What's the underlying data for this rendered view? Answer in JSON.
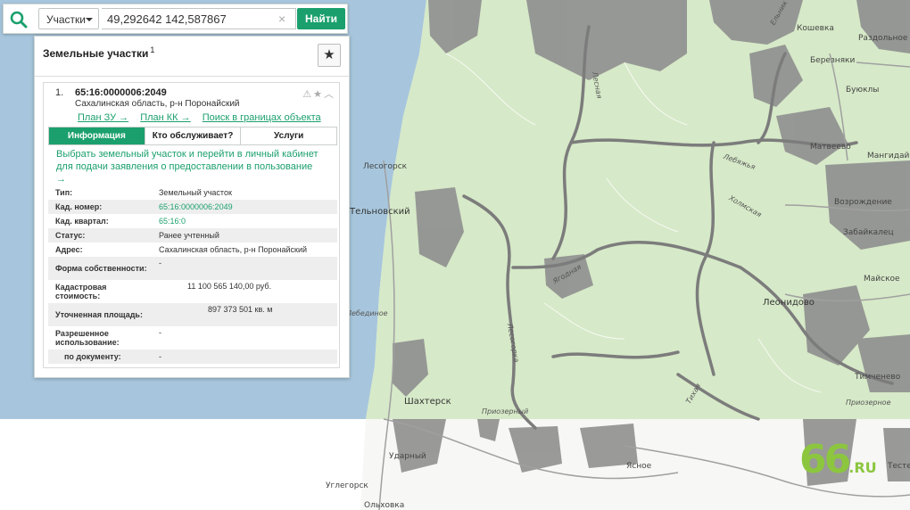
{
  "search": {
    "type_label": "Участки",
    "query_value": "49,292642 142,587867",
    "clear_symbol": "×",
    "submit_label": "Найти"
  },
  "panel": {
    "title": "Земельные участки",
    "title_count": "1",
    "favorite_symbol": "★",
    "result": {
      "index": "1.",
      "cadastral_number": "65:16:0000006:2049",
      "region": "Сахалинская область, р-н Поронайский",
      "tool_symbols": "⚠★︿",
      "links": [
        "План ЗУ →",
        "План КК →",
        "Поиск в границах объекта →"
      ],
      "tabs": [
        "Информация",
        "Кто обслуживает?",
        "Услуги"
      ],
      "cta": "Выбрать земельный участок и перейти в личный кабинет для подачи заявления о предоставлении в пользование →",
      "rows": [
        {
          "k": "Тип:",
          "v": "Земельный участок"
        },
        {
          "k": "Кад. номер:",
          "v": "65:16:0000006:2049"
        },
        {
          "k": "Кад. квартал:",
          "v": "65:16:0"
        },
        {
          "k": "Статус:",
          "v": "Ранее учтенный"
        },
        {
          "k": "Адрес:",
          "v": "Сахалинская область, р-н Поронайский"
        },
        {
          "k": "Форма собственности:",
          "v": "-"
        },
        {
          "k": "Кадастровая стоимость:",
          "v": "11 100 565 140,00 руб."
        },
        {
          "k": "Уточненная площадь:",
          "v": "897 373 501 кв. м"
        },
        {
          "k": "Разрешенное использование:",
          "v": "-"
        },
        {
          "k": "по документу:",
          "v": "-"
        }
      ]
    }
  },
  "map": {
    "places": [
      "Лесогорск",
      "Тельновский",
      "Шахтерск",
      "Ударный",
      "Углегорск",
      "Ольховка",
      "Леонидово",
      "Тимченево",
      "Матвеево",
      "Буюклы",
      "Кошевка",
      "Березняки",
      "Раздольное",
      "Возрождение",
      "Забайкалец",
      "Майское",
      "Мангидай",
      "Ясное",
      "Тесте",
      "Приозерный",
      "Приозерное",
      "Лебединое"
    ],
    "rivers": [
      "Лесная",
      "Лесогорка",
      "Ягодная",
      "Ельник",
      "Холмская",
      "Лебяжья",
      "Тихая"
    ],
    "colors": {
      "forest": "#d6e9c8",
      "grey": "#8f8f8f",
      "water": "#a7c6dd",
      "accent": "#1ba06d"
    },
    "watermark": {
      "main": "66",
      "suffix": ".RU"
    }
  }
}
